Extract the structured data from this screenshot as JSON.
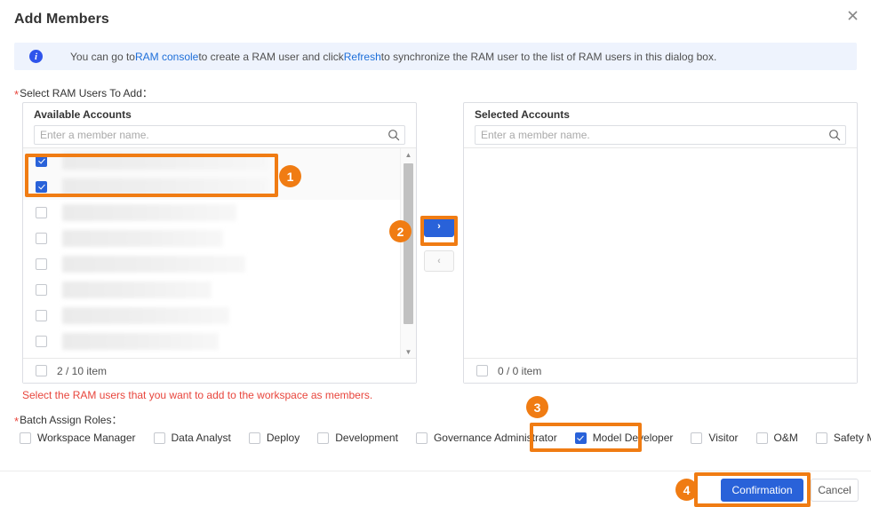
{
  "header": {
    "title": "Add Members",
    "close_icon": "close-icon"
  },
  "info_banner": {
    "icon": "info-circle-icon",
    "text_part1": "You can go to",
    "link1": "RAM console",
    "text_part2": "to create a RAM user and click",
    "link2": "Refresh",
    "text_part3": "to synchronize the RAM user to the list of RAM users in this dialog box."
  },
  "labels": {
    "select_users": "Select RAM Users To Add：",
    "batch_roles": "Batch Assign Roles：",
    "required_mark": "*"
  },
  "available_panel": {
    "title": "Available Accounts",
    "search_placeholder": "Enter a member name.",
    "search_value": "",
    "search_icon": "search-icon",
    "footer_count": "2 / 10 item",
    "footer_checkbox_checked": false,
    "rows": [
      {
        "checked": true,
        "name_width": 231,
        "redacted": true
      },
      {
        "checked": true,
        "name_width": 231,
        "redacted": true
      },
      {
        "checked": false,
        "name_width": 196,
        "redacted": true
      },
      {
        "checked": false,
        "name_width": 181,
        "redacted": true
      },
      {
        "checked": false,
        "name_width": 206,
        "redacted": true
      },
      {
        "checked": false,
        "name_width": 168,
        "redacted": true
      },
      {
        "checked": false,
        "name_width": 188,
        "redacted": true
      },
      {
        "checked": false,
        "name_width": 176,
        "redacted": true
      }
    ],
    "scrollbar": {
      "up_arrow_icon": "caret-up-icon",
      "down_arrow_icon": "caret-down-icon"
    }
  },
  "selected_panel": {
    "title": "Selected Accounts",
    "search_placeholder": "Enter a member name.",
    "search_value": "",
    "search_icon": "search-icon",
    "footer_count": "0 / 0 item",
    "footer_checkbox_checked": false,
    "rows": []
  },
  "transfer": {
    "to_right_label": "›",
    "to_left_label": "‹"
  },
  "validation": {
    "error_message": "Select the RAM users that you want to add to the workspace as members."
  },
  "roles": [
    {
      "label": "Workspace Manager",
      "checked": false
    },
    {
      "label": "Data Analyst",
      "checked": false
    },
    {
      "label": "Deploy",
      "checked": false
    },
    {
      "label": "Development",
      "checked": false
    },
    {
      "label": "Governance Administrator",
      "checked": false
    },
    {
      "label": "Model Developer",
      "checked": true
    },
    {
      "label": "Visitor",
      "checked": false
    },
    {
      "label": "O&M",
      "checked": false
    },
    {
      "label": "Safety Manager",
      "checked": false
    }
  ],
  "footer": {
    "confirm_label": "Confirmation",
    "cancel_label": "Cancel"
  },
  "annotations": {
    "accent_color": "#f07c13",
    "steps": [
      {
        "number": "1",
        "target": "selected-account-rows"
      },
      {
        "number": "2",
        "target": "move-right-button"
      },
      {
        "number": "3",
        "target": "role-model-developer"
      },
      {
        "number": "4",
        "target": "confirmation-button"
      }
    ]
  },
  "colors": {
    "primary": "#2962d9",
    "link": "#1e6fd9",
    "error": "#e8453c",
    "info_bg": "#eef3fd",
    "annotation": "#f07c13"
  }
}
